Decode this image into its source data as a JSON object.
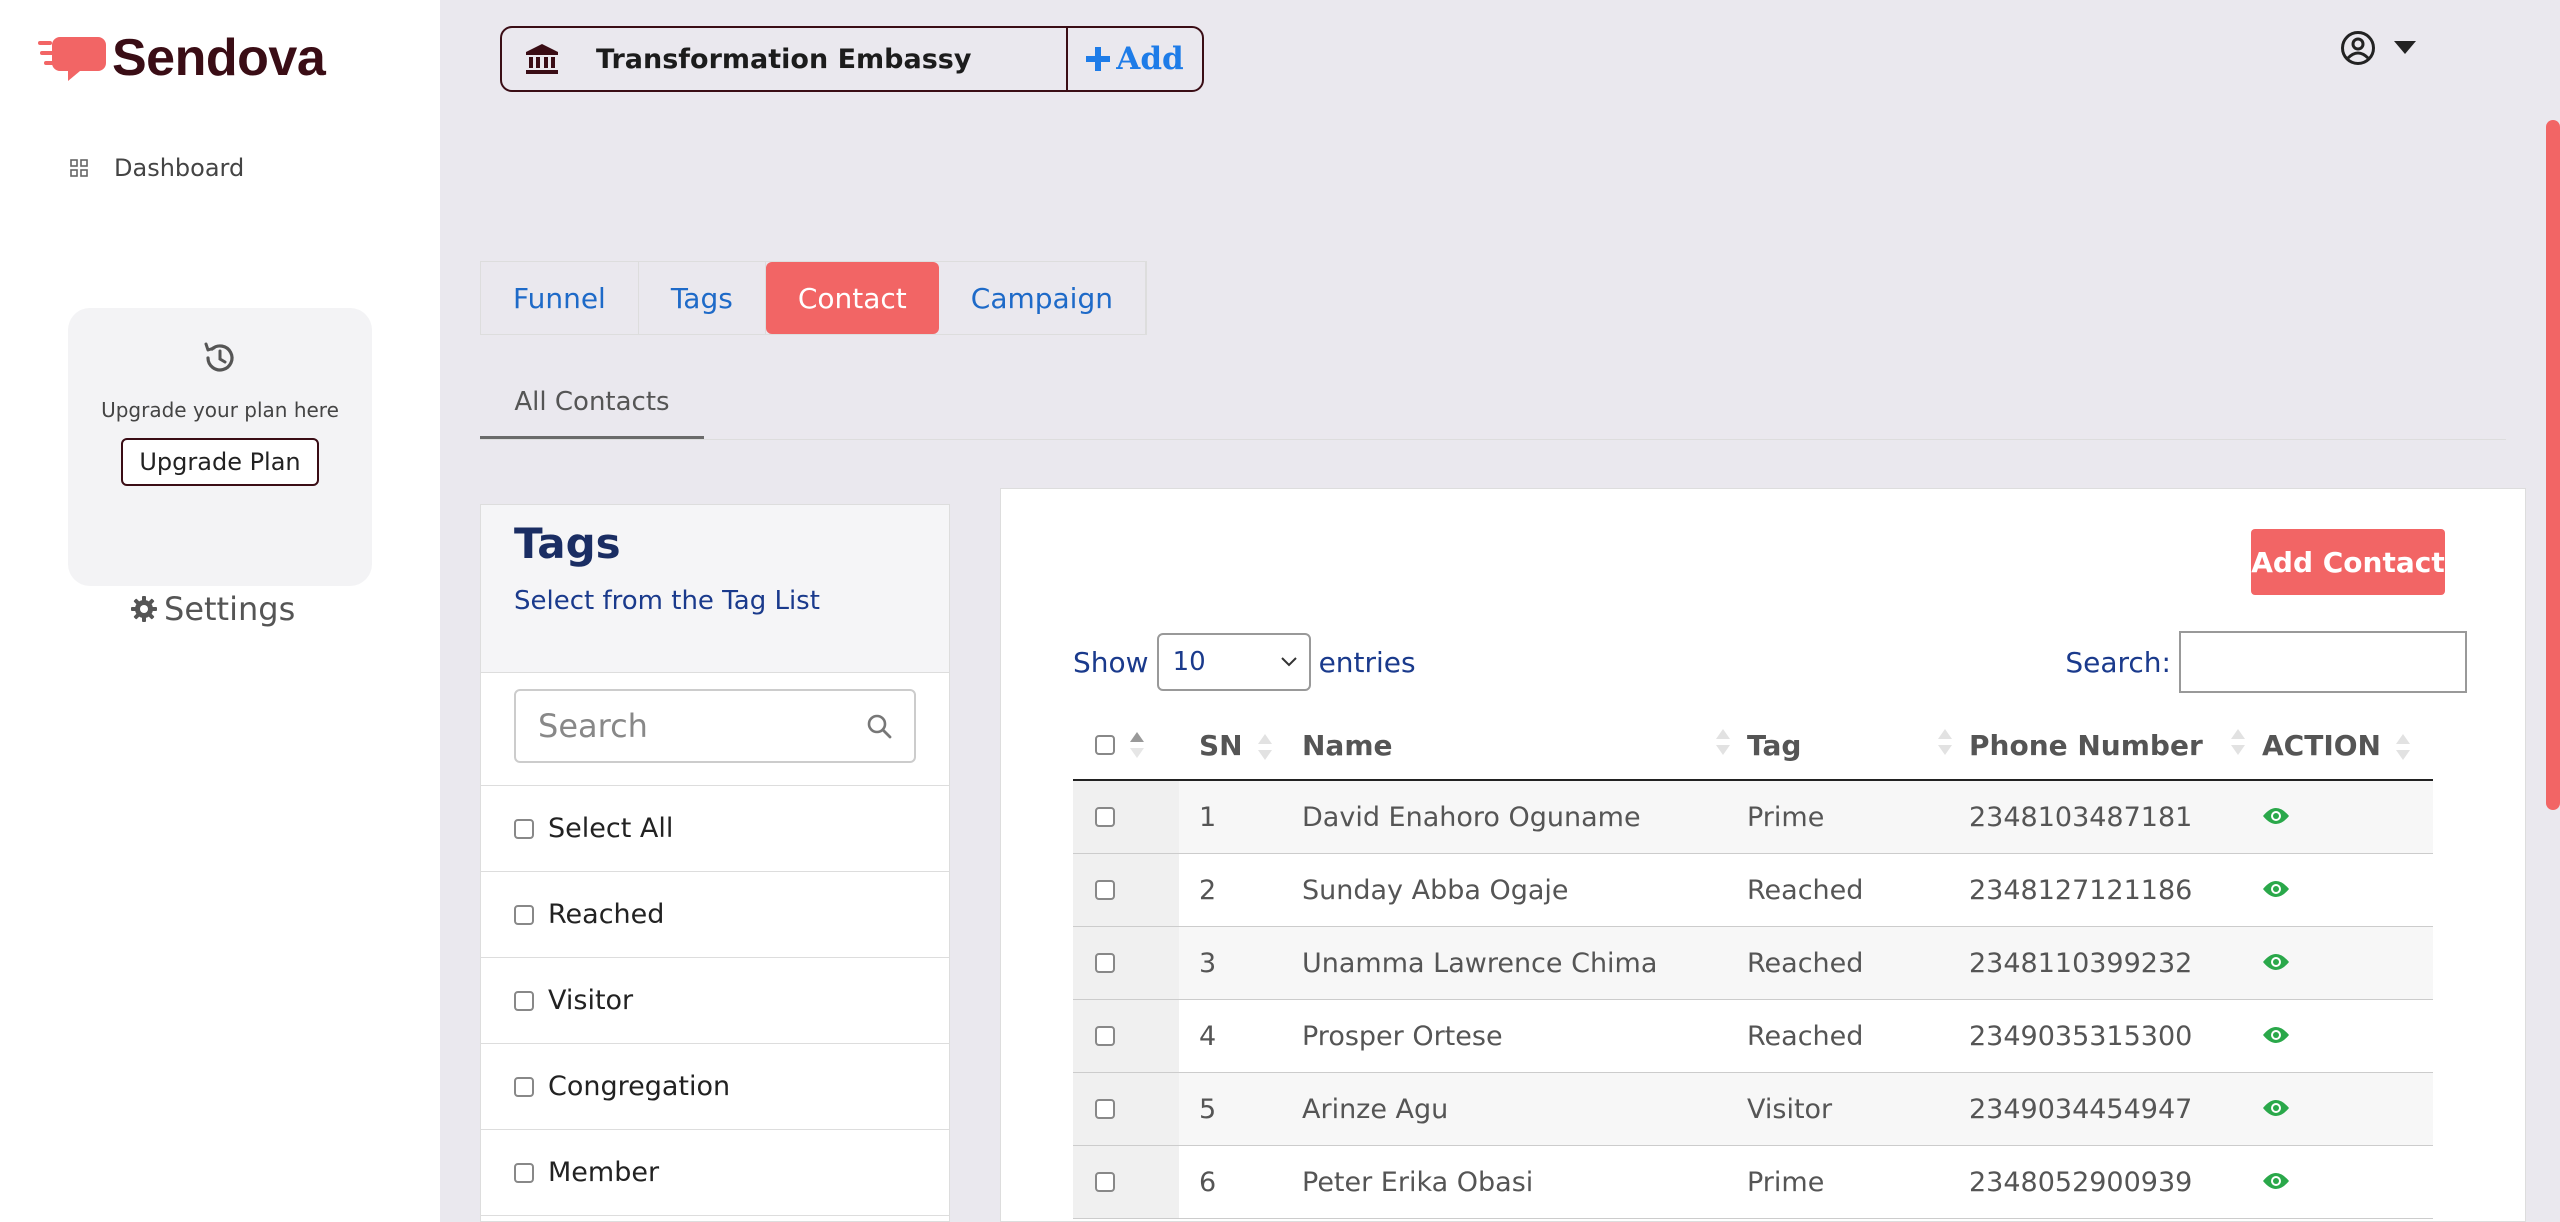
{
  "brand": {
    "name": "Sendova"
  },
  "sidebar": {
    "dashboard_label": "Dashboard",
    "upgrade_text": "Upgrade your plan here",
    "upgrade_button": "Upgrade Plan",
    "settings_label": "Settings"
  },
  "header": {
    "org_name": "Transformation Embassy",
    "add_label": "Add"
  },
  "tabs": [
    {
      "label": "Funnel",
      "active": false
    },
    {
      "label": "Tags",
      "active": false
    },
    {
      "label": "Contact",
      "active": true
    },
    {
      "label": "Campaign",
      "active": false
    }
  ],
  "subtab": "All Contacts",
  "tags_panel": {
    "title": "Tags",
    "subtitle": "Select from the Tag List",
    "search_placeholder": "Search",
    "items": [
      "Select All",
      "Reached",
      "Visitor",
      "Congregation",
      "Member"
    ]
  },
  "contacts": {
    "add_button": "Add Contact",
    "show_label": "Show",
    "entries_value": "10",
    "entries_label": "entries",
    "search_label": "Search:",
    "columns": [
      "SN",
      "Name",
      "Tag",
      "Phone Number",
      "ACTION"
    ],
    "rows": [
      {
        "sn": "1",
        "name": "David Enahoro Oguname",
        "tag": "Prime",
        "phone": "2348103487181"
      },
      {
        "sn": "2",
        "name": "Sunday Abba Ogaje",
        "tag": "Reached",
        "phone": "2348127121186"
      },
      {
        "sn": "3",
        "name": "Unamma Lawrence Chima",
        "tag": "Reached",
        "phone": "2348110399232"
      },
      {
        "sn": "4",
        "name": "Prosper Ortese",
        "tag": "Reached",
        "phone": "2349035315300"
      },
      {
        "sn": "5",
        "name": "Arinze Agu",
        "tag": "Visitor",
        "phone": "2349034454947"
      },
      {
        "sn": "6",
        "name": "Peter Erika Obasi",
        "tag": "Prime",
        "phone": "2348052900939"
      }
    ]
  },
  "colors": {
    "accent": "#f26565",
    "brand_dark": "#3a0d15",
    "link": "#1e6ac8",
    "action_eye": "#2aa84a"
  },
  "icons": [
    "bank-icon",
    "plus-icon",
    "user-circle-icon",
    "caret-down-icon",
    "grid-icon",
    "history-icon",
    "gear-icon",
    "search-icon",
    "eye-icon"
  ]
}
